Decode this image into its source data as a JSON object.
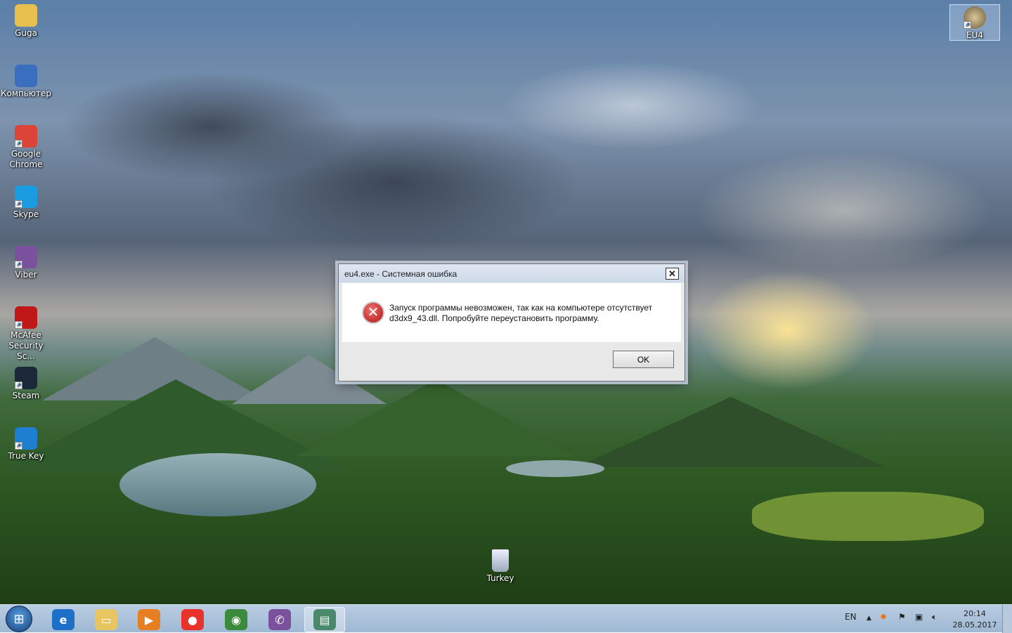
{
  "desktop": {
    "icons": [
      {
        "label": "Guga",
        "icon": "folder-icon",
        "color": "#e8c050"
      },
      {
        "label": "Компьютер",
        "icon": "computer-icon",
        "color": "#3a6fc0"
      },
      {
        "label": "Google Chrome",
        "icon": "chrome-icon",
        "color": "#db4437"
      },
      {
        "label": "Skype",
        "icon": "skype-icon",
        "color": "#1a9de0"
      },
      {
        "label": "Viber",
        "icon": "viber-icon",
        "color": "#7b519d"
      },
      {
        "label": "McAfee Security Sc...",
        "icon": "mcafee-icon",
        "color": "#c01818"
      },
      {
        "label": "Steam",
        "icon": "steam-icon",
        "color": "#1b2838"
      },
      {
        "label": "True Key",
        "icon": "truekey-icon",
        "color": "#1e7fd0"
      }
    ],
    "recycle_bin": {
      "label": "Turkey"
    },
    "eu4": {
      "label": "EU4"
    }
  },
  "dialog": {
    "title": "eu4.exe - Системная ошибка",
    "close": "✕",
    "message_line1": "Запуск программы невозможен, так как на компьютере отсутствует",
    "message_line2": "d3dx9_43.dll. Попробуйте переустановить программу.",
    "ok_label": "OK"
  },
  "taskbar": {
    "apps": [
      {
        "name": "internet-explorer",
        "glyph": "e",
        "color": "#1e6fc8"
      },
      {
        "name": "file-explorer",
        "glyph": "▭",
        "color": "#e7c560"
      },
      {
        "name": "media-player",
        "glyph": "▶",
        "color": "#e67e22"
      },
      {
        "name": "gom-player",
        "glyph": "●",
        "color": "#e8322a"
      },
      {
        "name": "chrome",
        "glyph": "◉",
        "color": "#3c8a3c"
      },
      {
        "name": "viber",
        "glyph": "✆",
        "color": "#7b519d"
      },
      {
        "name": "active-window",
        "glyph": "▤",
        "color": "#4a8a6a"
      }
    ],
    "lang": "EN",
    "time": "20:14",
    "date": "28.05.2017"
  }
}
